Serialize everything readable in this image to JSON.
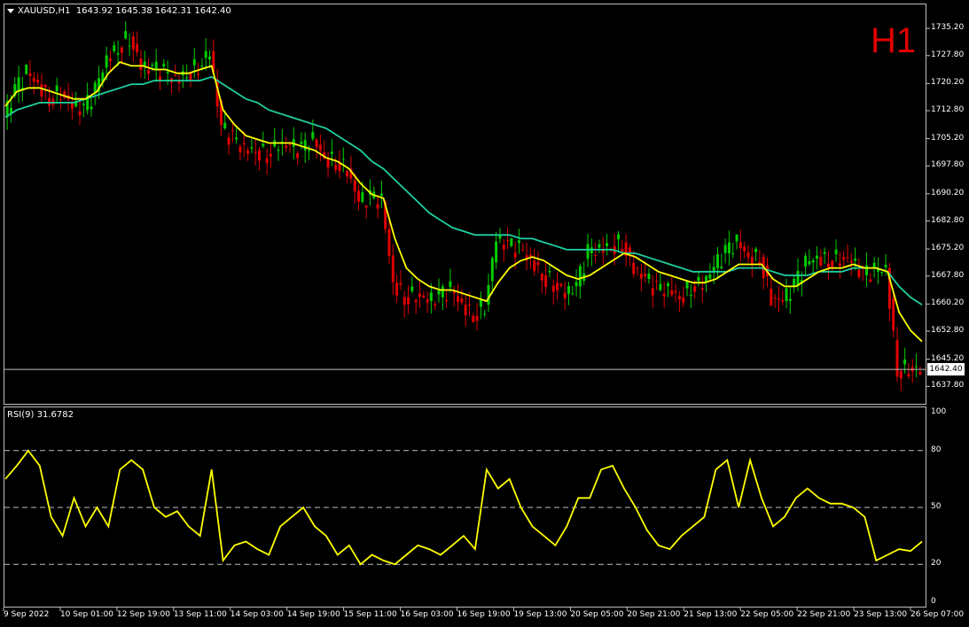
{
  "chart_header": {
    "symbol_info": "XAUUSD,H1",
    "ohlc": "1643.92 1645.38 1642.31 1642.40"
  },
  "timeframe_label": "H1",
  "price_axis": {
    "ticks": [
      "1735.20",
      "1727.80",
      "1720.20",
      "1712.80",
      "1705.20",
      "1697.80",
      "1690.20",
      "1682.80",
      "1675.20",
      "1667.80",
      "1660.20",
      "1652.80",
      "1645.20",
      "1637.80"
    ]
  },
  "current_price": "1642.40",
  "rsi": {
    "label": "RSI(9) 31.6782",
    "ticks": [
      "100",
      "80",
      "50",
      "20",
      "0"
    ],
    "levels": [
      80,
      50,
      20
    ]
  },
  "time_axis": {
    "ticks": [
      "9 Sep 2022",
      "10 Sep 01:00",
      "12 Sep 19:00",
      "13 Sep 11:00",
      "14 Sep 03:00",
      "14 Sep 19:00",
      "15 Sep 11:00",
      "16 Sep 03:00",
      "16 Sep 19:00",
      "19 Sep 13:00",
      "20 Sep 05:00",
      "20 Sep 21:00",
      "21 Sep 13:00",
      "22 Sep 05:00",
      "22 Sep 21:00",
      "23 Sep 13:00",
      "26 Sep 07:00"
    ]
  },
  "colors": {
    "bull": "#00cc00",
    "bear": "#e00000",
    "ma_fast": "#ffff00",
    "ma_slow": "#20d0a0",
    "rsi_line": "#ffff00"
  },
  "chart_data": {
    "type": "candlestick",
    "price_series": [
      1711,
      1718,
      1723,
      1720,
      1716,
      1718,
      1714,
      1713,
      1718,
      1727,
      1730,
      1733,
      1725,
      1724,
      1723,
      1721,
      1723,
      1725,
      1729,
      1708,
      1705,
      1702,
      1702,
      1701,
      1704,
      1703,
      1702,
      1705,
      1700,
      1699,
      1697,
      1688,
      1689,
      1688,
      1666,
      1662,
      1663,
      1661,
      1662,
      1664,
      1660,
      1657,
      1660,
      1678,
      1676,
      1675,
      1672,
      1668,
      1666,
      1663,
      1665,
      1674,
      1675,
      1676,
      1677,
      1670,
      1667,
      1664,
      1664,
      1662,
      1665,
      1666,
      1670,
      1674,
      1677,
      1673,
      1673,
      1662,
      1661,
      1665,
      1671,
      1673,
      1672,
      1673,
      1672,
      1668,
      1669,
      1670,
      1642,
      1643,
      1642
    ],
    "ma_fast": [
      1714,
      1718,
      1719,
      1719,
      1718,
      1717,
      1716,
      1716,
      1718,
      1723,
      1726,
      1725,
      1725,
      1724,
      1724,
      1723,
      1723,
      1724,
      1725,
      1713,
      1709,
      1706,
      1705,
      1704,
      1704,
      1704,
      1703,
      1702,
      1700,
      1699,
      1697,
      1693,
      1690,
      1689,
      1678,
      1670,
      1667,
      1665,
      1664,
      1664,
      1663,
      1662,
      1661,
      1666,
      1670,
      1672,
      1673,
      1672,
      1670,
      1668,
      1667,
      1668,
      1670,
      1672,
      1674,
      1673,
      1671,
      1669,
      1668,
      1667,
      1666,
      1666,
      1667,
      1669,
      1671,
      1671,
      1671,
      1667,
      1665,
      1665,
      1667,
      1669,
      1670,
      1670,
      1671,
      1670,
      1670,
      1669,
      1658,
      1653,
      1650
    ],
    "ma_slow": [
      1711,
      1713,
      1714,
      1715,
      1715,
      1715,
      1715,
      1716,
      1717,
      1718,
      1719,
      1720,
      1720,
      1721,
      1721,
      1721,
      1721,
      1721,
      1722,
      1720,
      1718,
      1716,
      1715,
      1713,
      1712,
      1711,
      1710,
      1709,
      1708,
      1706,
      1704,
      1702,
      1699,
      1697,
      1694,
      1691,
      1688,
      1685,
      1683,
      1681,
      1680,
      1679,
      1679,
      1679,
      1679,
      1678,
      1678,
      1677,
      1676,
      1675,
      1675,
      1675,
      1675,
      1675,
      1674,
      1674,
      1673,
      1672,
      1671,
      1670,
      1669,
      1669,
      1669,
      1669,
      1670,
      1670,
      1670,
      1669,
      1668,
      1668,
      1668,
      1669,
      1669,
      1669,
      1670,
      1670,
      1670,
      1669,
      1665,
      1662,
      1660
    ],
    "rsi_series": [
      65,
      72,
      80,
      72,
      45,
      35,
      55,
      40,
      50,
      40,
      70,
      75,
      70,
      50,
      45,
      48,
      40,
      35,
      70,
      22,
      30,
      32,
      28,
      25,
      40,
      45,
      50,
      40,
      35,
      25,
      30,
      20,
      25,
      22,
      20,
      25,
      30,
      28,
      25,
      30,
      35,
      28,
      70,
      60,
      65,
      50,
      40,
      35,
      30,
      40,
      55,
      55,
      70,
      72,
      60,
      50,
      38,
      30,
      28,
      35,
      40,
      45,
      70,
      75,
      50,
      75,
      55,
      40,
      45,
      55,
      60,
      55,
      52,
      52,
      50,
      45,
      22,
      25,
      28,
      27,
      32
    ],
    "rsi_range": [
      0,
      100
    ],
    "ylim": [
      1634,
      1741
    ]
  }
}
